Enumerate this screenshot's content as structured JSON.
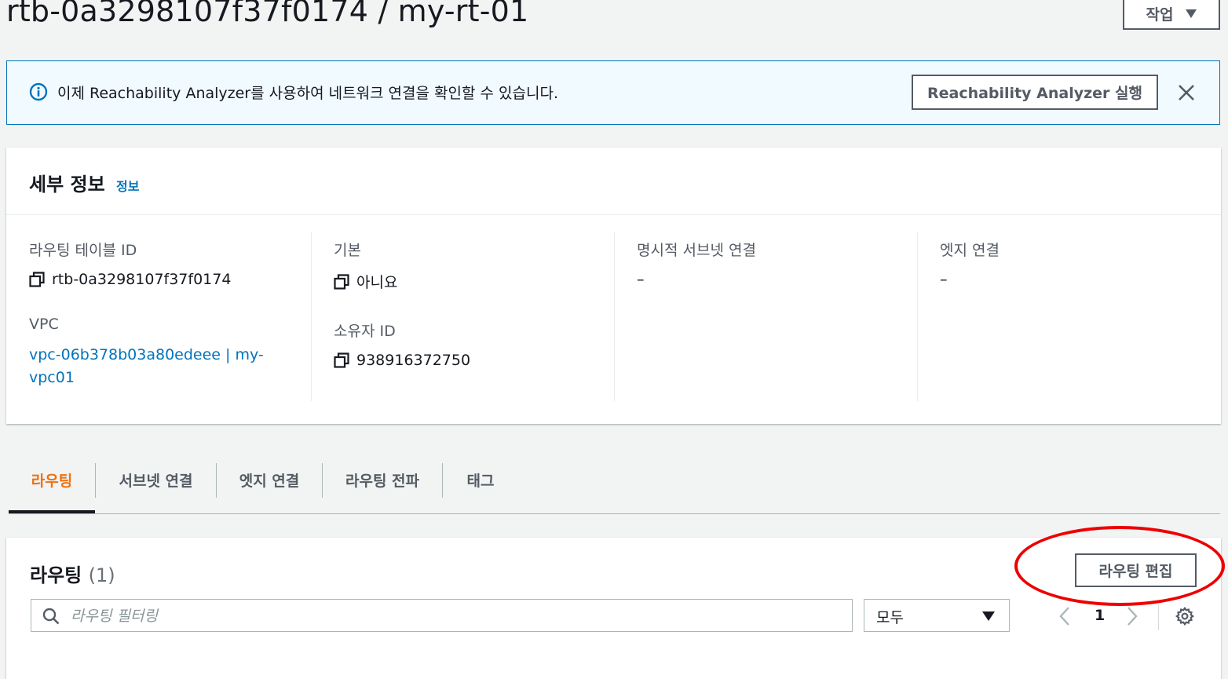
{
  "header": {
    "title": "rtb-0a3298107f37f0174 / my-rt-01",
    "actions_label": "작업"
  },
  "banner": {
    "text": "이제 Reachability Analyzer를 사용하여 네트워크 연결을 확인할 수 있습니다.",
    "button_label": "Reachability Analyzer 실행",
    "icon": "info-circle-icon",
    "close_icon": "close-icon"
  },
  "details": {
    "title": "세부 정보",
    "info_link": "정보",
    "route_table_id_label": "라우팅 테이블 ID",
    "route_table_id": "rtb-0a3298107f37f0174",
    "vpc_label": "VPC",
    "vpc_value": "vpc-06b378b03a80edeee | my-vpc01",
    "main_label": "기본",
    "main_value": "아니요",
    "owner_label": "소유자 ID",
    "owner_value": "938916372750",
    "explicit_subnet_label": "명시적 서브넷 연결",
    "explicit_subnet_value": "–",
    "edge_label": "엣지 연결",
    "edge_value": "–"
  },
  "tabs": [
    {
      "label": "라우팅",
      "active": true
    },
    {
      "label": "서브넷 연결",
      "active": false
    },
    {
      "label": "엣지 연결",
      "active": false
    },
    {
      "label": "라우팅 전파",
      "active": false
    },
    {
      "label": "태그",
      "active": false
    }
  ],
  "routes": {
    "title": "라우팅",
    "count": "(1)",
    "edit_label": "라우팅 편집",
    "filter_placeholder": "라우팅 필터링",
    "select_value": "모두",
    "page": "1"
  },
  "colors": {
    "accent_link": "#0073bb",
    "active_tab": "#ec7211",
    "annotation": "#ee0000"
  }
}
